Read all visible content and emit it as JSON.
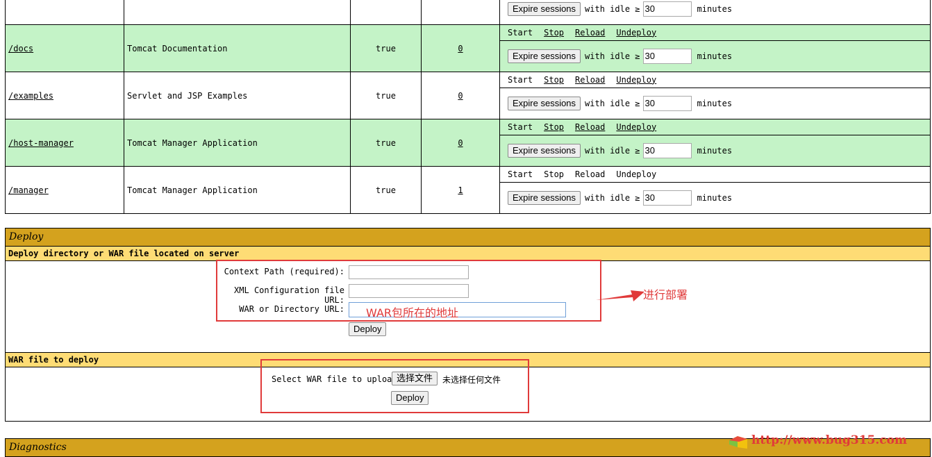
{
  "apps": {
    "rows": [
      {
        "path": "/docs",
        "display": "Tomcat Documentation",
        "running": "true",
        "sessions": "0",
        "alt": true,
        "links": true
      },
      {
        "path": "/examples",
        "display": "Servlet and JSP Examples",
        "running": "true",
        "sessions": "0",
        "alt": false,
        "links": true
      },
      {
        "path": "/host-manager",
        "display": "Tomcat Manager Application",
        "running": "true",
        "sessions": "0",
        "alt": true,
        "links": true
      },
      {
        "path": "/manager",
        "display": "Tomcat Manager Application",
        "running": "true",
        "sessions": "1",
        "alt": false,
        "links": false
      }
    ],
    "top_partial": {
      "expire_label": "Expire sessions",
      "with_idle": "with idle ≥",
      "idle": "30",
      "minutes": "minutes"
    },
    "commands": {
      "start": "Start",
      "stop": "Stop",
      "reload": "Reload",
      "undeploy": "Undeploy"
    },
    "expire_label": "Expire sessions",
    "with_idle": "with idle ≥",
    "idle_value": "30",
    "minutes": "minutes"
  },
  "deploy": {
    "title": "Deploy",
    "server_subtitle": "Deploy directory or WAR file located on server",
    "context_path_label": "Context Path (required):",
    "xml_config_label": "XML Configuration file URL:",
    "war_dir_label": "WAR or Directory URL:",
    "war_dir_value": "WAR包所在的地址",
    "deploy_button": "Deploy",
    "annotation": "进行部署",
    "upload_subtitle": "WAR file to deploy",
    "select_label": "Select WAR file to upload",
    "choose_file_button": "选择文件",
    "no_file_chosen": "未选择任何文件",
    "upload_deploy_button": "Deploy"
  },
  "diagnostics": {
    "title": "Diagnostics"
  },
  "watermark": {
    "url": "http://www.bug315.com"
  },
  "colors": {
    "row_alt": "#c4f3c7",
    "section_title": "#d4a21e",
    "section_sub": "#fedc75",
    "annotation_red": "#e03a3a"
  }
}
